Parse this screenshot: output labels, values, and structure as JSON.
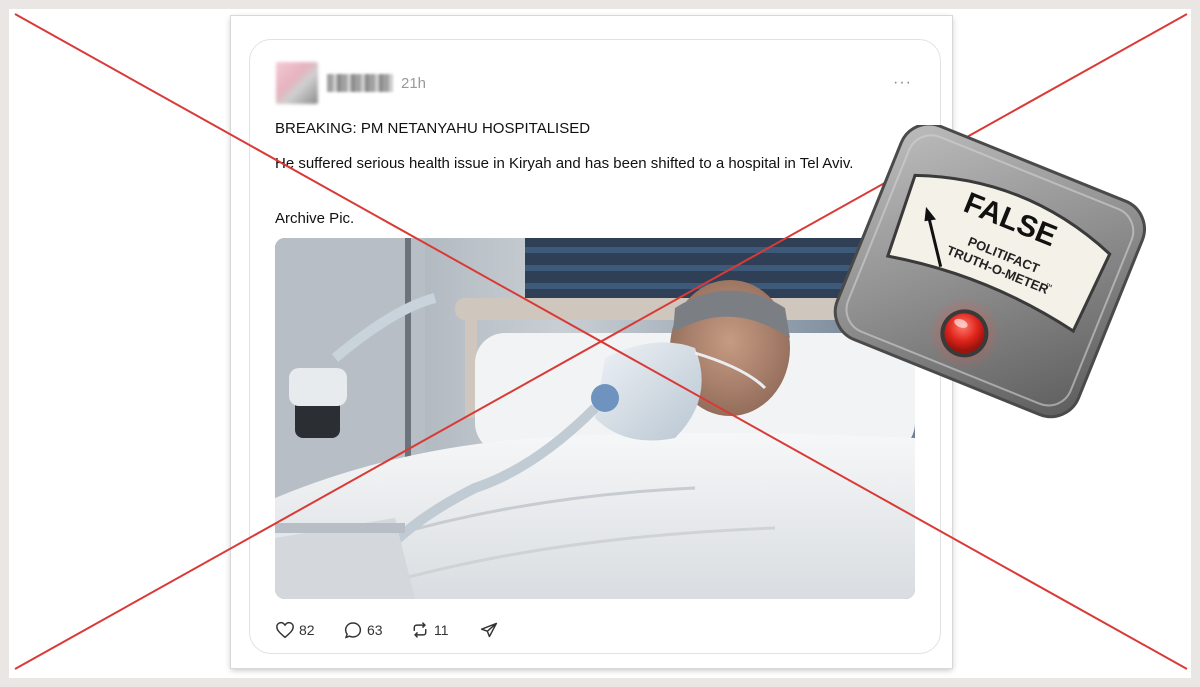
{
  "post": {
    "time": "21h",
    "more": "···",
    "headline": "BREAKING: PM NETANYAHU HOSPITALISED",
    "body": "He suffered serious health issue in Kiryah and has been shifted to a hospital in Tel Aviv.",
    "archive": "Archive Pic."
  },
  "actions": {
    "likes": "82",
    "replies": "63",
    "reposts": "11"
  },
  "rating": {
    "verdict": "FALSE",
    "brand_line1": "POLITIFACT",
    "brand_line2": "TRUTH-O-METER",
    "tm": "™"
  },
  "colors": {
    "cross": "#d93a36",
    "meter_red": "#e0251c",
    "meter_body": "#8e8e8e"
  },
  "icons": [
    "heart-icon",
    "comment-icon",
    "repost-icon",
    "share-icon",
    "more-icon"
  ]
}
